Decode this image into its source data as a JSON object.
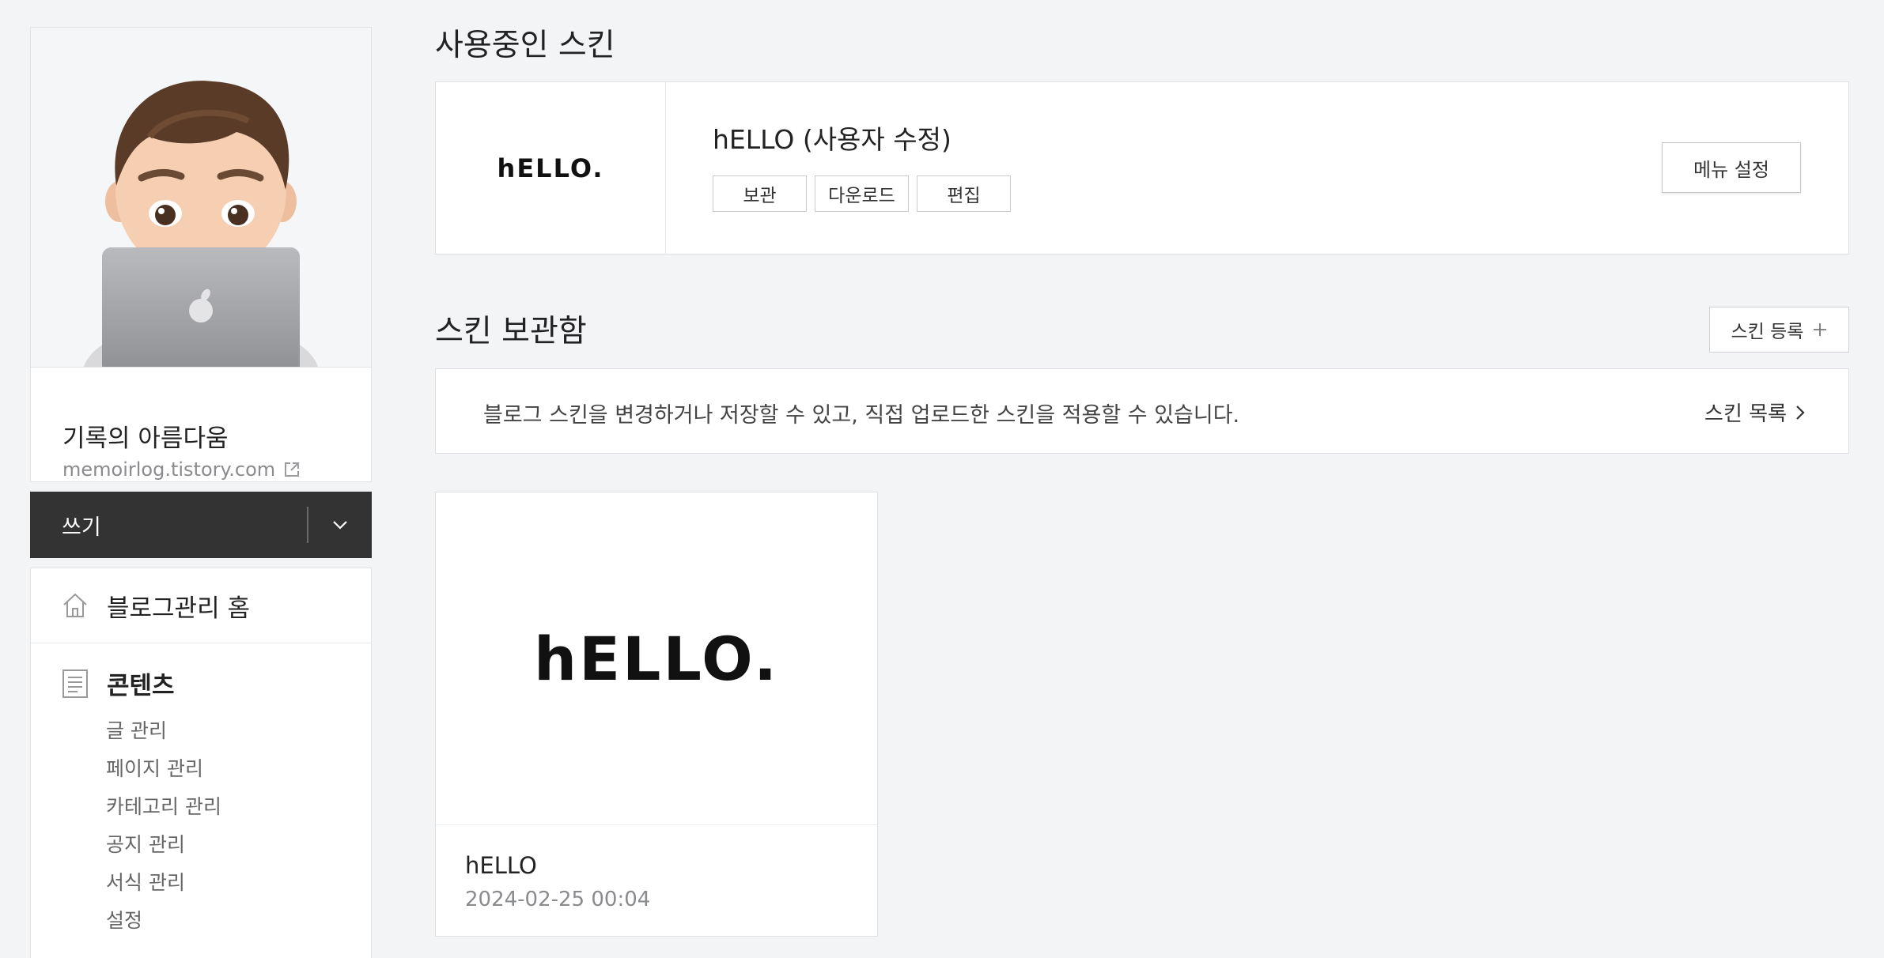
{
  "sidebar": {
    "blog_name": "기록의 아름다움",
    "blog_url": "memoirlog.tistory.com",
    "write_label": "쓰기",
    "home_label": "블로그관리 홈",
    "content_label": "콘텐츠",
    "content_items": [
      "글 관리",
      "페이지 관리",
      "카테고리 관리",
      "공지 관리",
      "서식 관리",
      "설정"
    ]
  },
  "current_skin": {
    "section_title": "사용중인 스킨",
    "logo_text": "hELLO.",
    "name": "hELLO (사용자 수정)",
    "buttons": [
      "보관",
      "다운로드",
      "편집"
    ],
    "menu_setting_label": "메뉴 설정"
  },
  "skin_storage": {
    "section_title": "스킨 보관함",
    "register_label": "스킨 등록",
    "info_text": "블로그 스킨을 변경하거나 저장할 수 있고, 직접 업로드한 스킨을 적용할 수 있습니다.",
    "list_link_label": "스킨 목록",
    "cards": [
      {
        "logo_text": "hELLO.",
        "name": "hELLO",
        "date": "2024-02-25 00:04"
      }
    ]
  },
  "colors": {
    "background": "#f3f4f6",
    "write_bar": "#333333",
    "card_border": "#dfe0e3"
  }
}
